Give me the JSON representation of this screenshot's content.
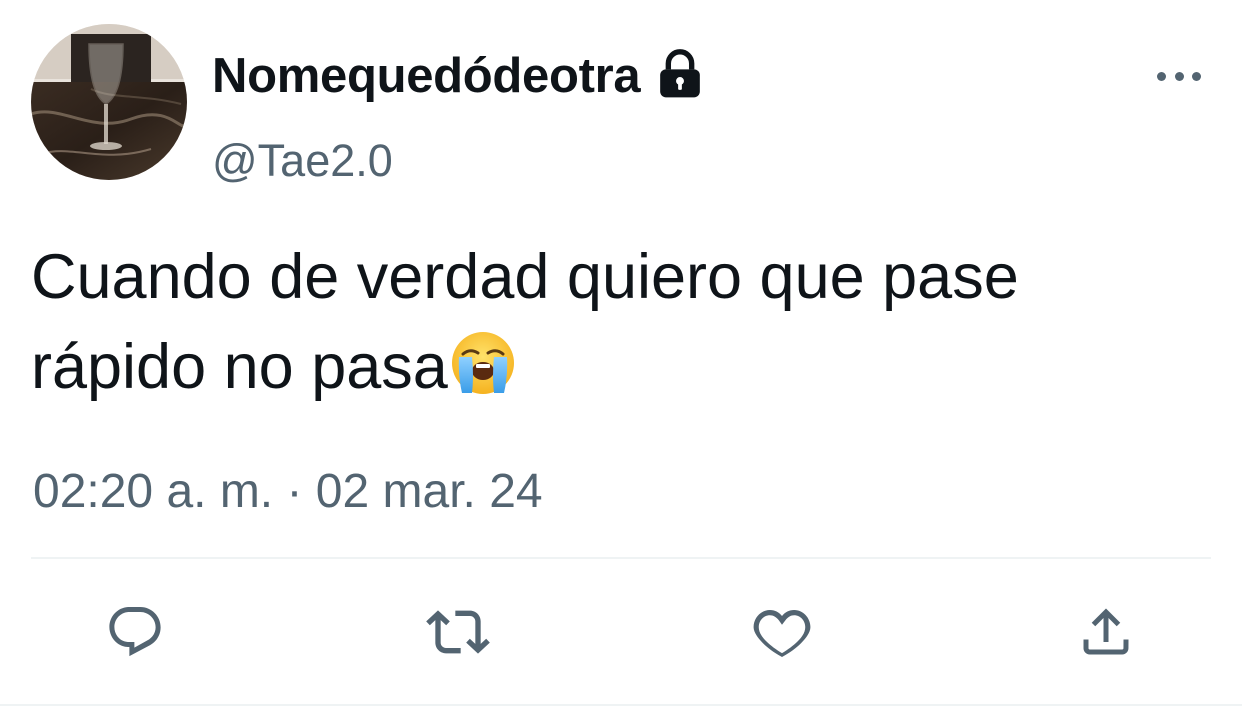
{
  "user": {
    "display_name": "Nomequedódeotra",
    "handle": "@Tae2.0",
    "protected_icon": "lock-icon",
    "avatar_icon": "avatar-wine-glass"
  },
  "tweet": {
    "text": "Cuando de verdad quiero que pase\nrápido no pasa",
    "emoji": "loudly-crying-face",
    "timestamp": "02:20 a. m. · 02 mar. 24"
  },
  "actions": [
    {
      "icon": "reply-icon"
    },
    {
      "icon": "retweet-icon"
    },
    {
      "icon": "like-icon"
    },
    {
      "icon": "share-icon"
    }
  ],
  "more_icon": "more-options-icon",
  "colors": {
    "text_primary": "#0f1419",
    "text_secondary": "#536471",
    "divider": "#eff3f4"
  }
}
